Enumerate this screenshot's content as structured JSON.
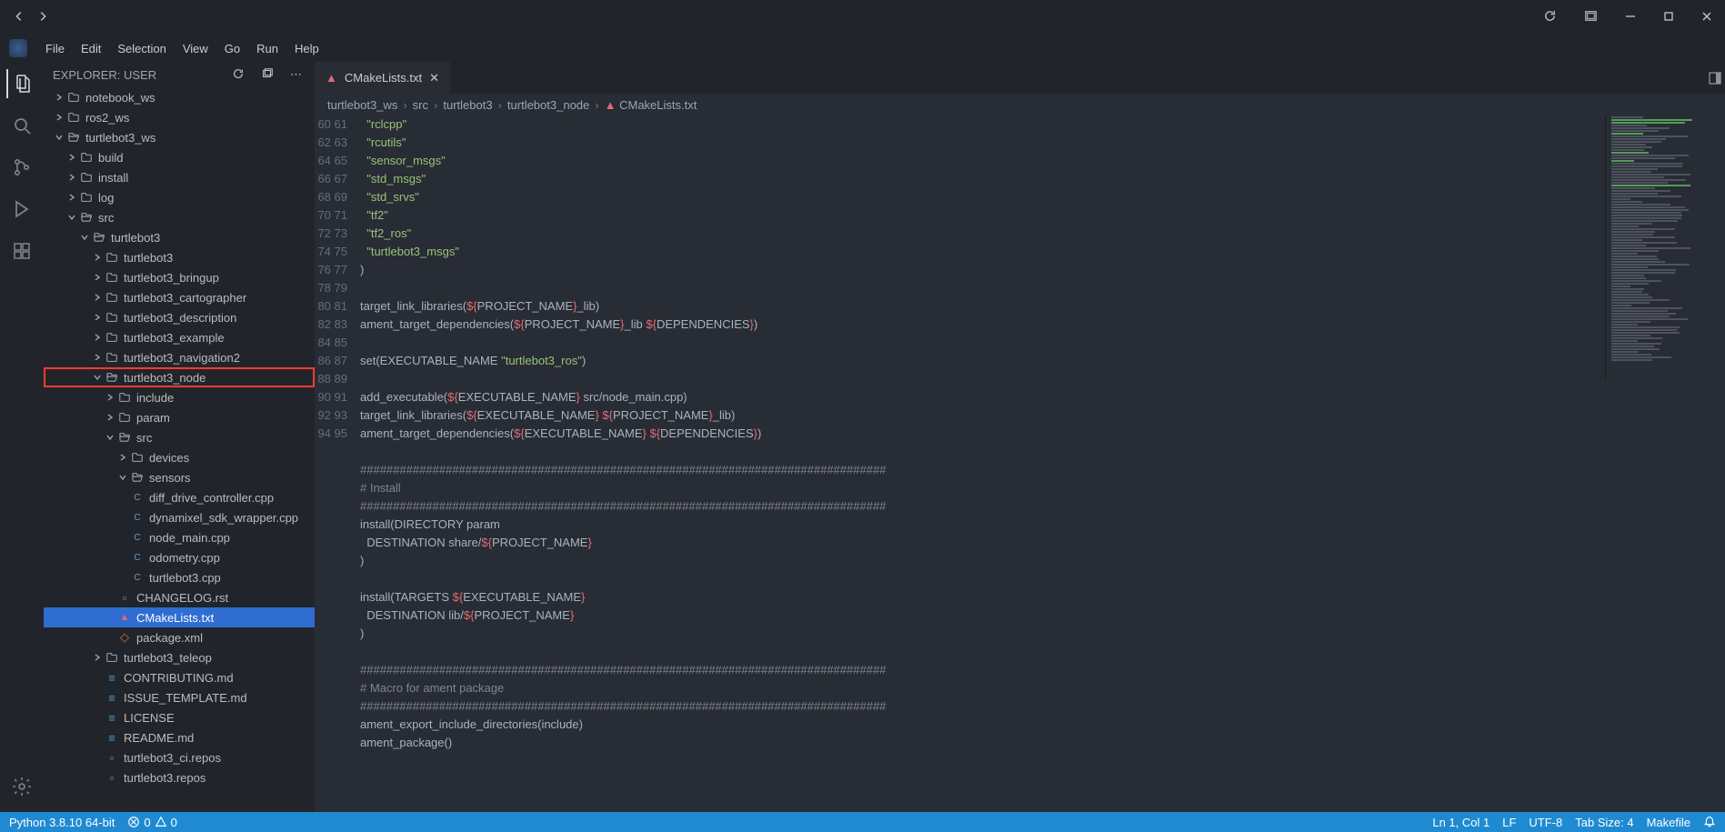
{
  "titlebar": {},
  "menu": {
    "items": [
      "File",
      "Edit",
      "Selection",
      "View",
      "Go",
      "Run",
      "Help"
    ]
  },
  "sidebar": {
    "header": "EXPLORER: USER",
    "tree": [
      {
        "d": 1,
        "t": "cf",
        "l": "notebook_ws"
      },
      {
        "d": 1,
        "t": "cf",
        "l": "ros2_ws"
      },
      {
        "d": 1,
        "t": "of",
        "l": "turtlebot3_ws"
      },
      {
        "d": 2,
        "t": "cf",
        "l": "build"
      },
      {
        "d": 2,
        "t": "cf",
        "l": "install"
      },
      {
        "d": 2,
        "t": "cf",
        "l": "log"
      },
      {
        "d": 2,
        "t": "of",
        "l": "src"
      },
      {
        "d": 3,
        "t": "of",
        "l": "turtlebot3"
      },
      {
        "d": 4,
        "t": "cf",
        "l": "turtlebot3"
      },
      {
        "d": 4,
        "t": "cf",
        "l": "turtlebot3_bringup"
      },
      {
        "d": 4,
        "t": "cf",
        "l": "turtlebot3_cartographer"
      },
      {
        "d": 4,
        "t": "cf",
        "l": "turtlebot3_description"
      },
      {
        "d": 4,
        "t": "cf",
        "l": "turtlebot3_example"
      },
      {
        "d": 4,
        "t": "cf",
        "l": "turtlebot3_navigation2"
      },
      {
        "d": 4,
        "t": "of",
        "l": "turtlebot3_node",
        "hl": true
      },
      {
        "d": 5,
        "t": "cf",
        "l": "include"
      },
      {
        "d": 5,
        "t": "cf",
        "l": "param"
      },
      {
        "d": 5,
        "t": "of",
        "l": "src"
      },
      {
        "d": 6,
        "t": "cf",
        "l": "devices"
      },
      {
        "d": 6,
        "t": "of",
        "l": "sensors"
      },
      {
        "d": 6,
        "t": "fc",
        "l": "diff_drive_controller.cpp"
      },
      {
        "d": 6,
        "t": "fc",
        "l": "dynamixel_sdk_wrapper.cpp"
      },
      {
        "d": 6,
        "t": "fc",
        "l": "node_main.cpp"
      },
      {
        "d": 6,
        "t": "fc",
        "l": "odometry.cpp"
      },
      {
        "d": 6,
        "t": "fc",
        "l": "turtlebot3.cpp"
      },
      {
        "d": 5,
        "t": "fr",
        "l": "CHANGELOG.rst"
      },
      {
        "d": 5,
        "t": "ft",
        "l": "CMakeLists.txt",
        "sel": true
      },
      {
        "d": 5,
        "t": "fx",
        "l": "package.xml"
      },
      {
        "d": 4,
        "t": "cf",
        "l": "turtlebot3_teleop"
      },
      {
        "d": 4,
        "t": "fm",
        "l": "CONTRIBUTING.md"
      },
      {
        "d": 4,
        "t": "fm",
        "l": "ISSUE_TEMPLATE.md"
      },
      {
        "d": 4,
        "t": "fm",
        "l": "LICENSE"
      },
      {
        "d": 4,
        "t": "fm",
        "l": "README.md"
      },
      {
        "d": 4,
        "t": "fg",
        "l": "turtlebot3_ci.repos"
      },
      {
        "d": 4,
        "t": "fg",
        "l": "turtlebot3.repos"
      }
    ]
  },
  "editor": {
    "tab_label": "CMakeLists.txt",
    "breadcrumbs": [
      "turtlebot3_ws",
      "src",
      "turtlebot3",
      "turtlebot3_node",
      "CMakeLists.txt"
    ],
    "first_line": 60,
    "lines": [
      [
        [
          1,
          "  \"rclcpp\""
        ]
      ],
      [
        [
          1,
          "  \"rcutils\""
        ]
      ],
      [
        [
          1,
          "  \"sensor_msgs\""
        ]
      ],
      [
        [
          1,
          "  \"std_msgs\""
        ]
      ],
      [
        [
          1,
          "  \"std_srvs\""
        ]
      ],
      [
        [
          1,
          "  \"tf2\""
        ]
      ],
      [
        [
          1,
          "  \"tf2_ros\""
        ]
      ],
      [
        [
          1,
          "  \"turtlebot3_msgs\""
        ]
      ],
      [
        [
          0,
          ")"
        ]
      ],
      [
        [
          0,
          ""
        ]
      ],
      [
        [
          0,
          "target_link_libraries("
        ],
        [
          2,
          "${"
        ],
        [
          0,
          "PROJECT_NAME"
        ],
        [
          2,
          "}"
        ],
        [
          0,
          "_lib)"
        ]
      ],
      [
        [
          0,
          "ament_target_dependencies("
        ],
        [
          2,
          "${"
        ],
        [
          0,
          "PROJECT_NAME"
        ],
        [
          2,
          "}"
        ],
        [
          0,
          "_lib "
        ],
        [
          2,
          "${"
        ],
        [
          0,
          "DEPENDENCIES"
        ],
        [
          2,
          "}"
        ],
        [
          0,
          ")"
        ]
      ],
      [
        [
          0,
          ""
        ]
      ],
      [
        [
          0,
          "set(EXECUTABLE_NAME "
        ],
        [
          1,
          "\"turtlebot3_ros\""
        ],
        [
          0,
          ")"
        ]
      ],
      [
        [
          0,
          ""
        ]
      ],
      [
        [
          0,
          "add_executable("
        ],
        [
          2,
          "${"
        ],
        [
          0,
          "EXECUTABLE_NAME"
        ],
        [
          2,
          "}"
        ],
        [
          0,
          " src/node_main.cpp)"
        ]
      ],
      [
        [
          0,
          "target_link_libraries("
        ],
        [
          2,
          "${"
        ],
        [
          0,
          "EXECUTABLE_NAME"
        ],
        [
          2,
          "}"
        ],
        [
          0,
          " "
        ],
        [
          2,
          "${"
        ],
        [
          0,
          "PROJECT_NAME"
        ],
        [
          2,
          "}"
        ],
        [
          0,
          "_lib)"
        ]
      ],
      [
        [
          0,
          "ament_target_dependencies("
        ],
        [
          2,
          "${"
        ],
        [
          0,
          "EXECUTABLE_NAME"
        ],
        [
          2,
          "}"
        ],
        [
          0,
          " "
        ],
        [
          2,
          "${"
        ],
        [
          0,
          "DEPENDENCIES"
        ],
        [
          2,
          "}"
        ],
        [
          0,
          ")"
        ]
      ],
      [
        [
          0,
          ""
        ]
      ],
      [
        [
          3,
          "################################################################################"
        ]
      ],
      [
        [
          3,
          "# Install"
        ]
      ],
      [
        [
          3,
          "################################################################################"
        ]
      ],
      [
        [
          0,
          "install(DIRECTORY param"
        ]
      ],
      [
        [
          0,
          "  DESTINATION share/"
        ],
        [
          2,
          "${"
        ],
        [
          0,
          "PROJECT_NAME"
        ],
        [
          2,
          "}"
        ]
      ],
      [
        [
          0,
          ")"
        ]
      ],
      [
        [
          0,
          ""
        ]
      ],
      [
        [
          0,
          "install(TARGETS "
        ],
        [
          2,
          "${"
        ],
        [
          0,
          "EXECUTABLE_NAME"
        ],
        [
          2,
          "}"
        ]
      ],
      [
        [
          0,
          "  DESTINATION lib/"
        ],
        [
          2,
          "${"
        ],
        [
          0,
          "PROJECT_NAME"
        ],
        [
          2,
          "}"
        ]
      ],
      [
        [
          0,
          ")"
        ]
      ],
      [
        [
          0,
          ""
        ]
      ],
      [
        [
          3,
          "################################################################################"
        ]
      ],
      [
        [
          3,
          "# Macro for ament package"
        ]
      ],
      [
        [
          3,
          "################################################################################"
        ]
      ],
      [
        [
          0,
          "ament_export_include_directories(include)"
        ]
      ],
      [
        [
          0,
          "ament_package()"
        ]
      ],
      [
        [
          0,
          ""
        ]
      ]
    ]
  },
  "statusbar": {
    "python": "Python 3.8.10 64-bit",
    "errors": "0",
    "warnings": "0",
    "ln_col": "Ln 1, Col 1",
    "eol": "LF",
    "encoding": "UTF-8",
    "tab_size": "Tab Size: 4",
    "language": "Makefile"
  }
}
